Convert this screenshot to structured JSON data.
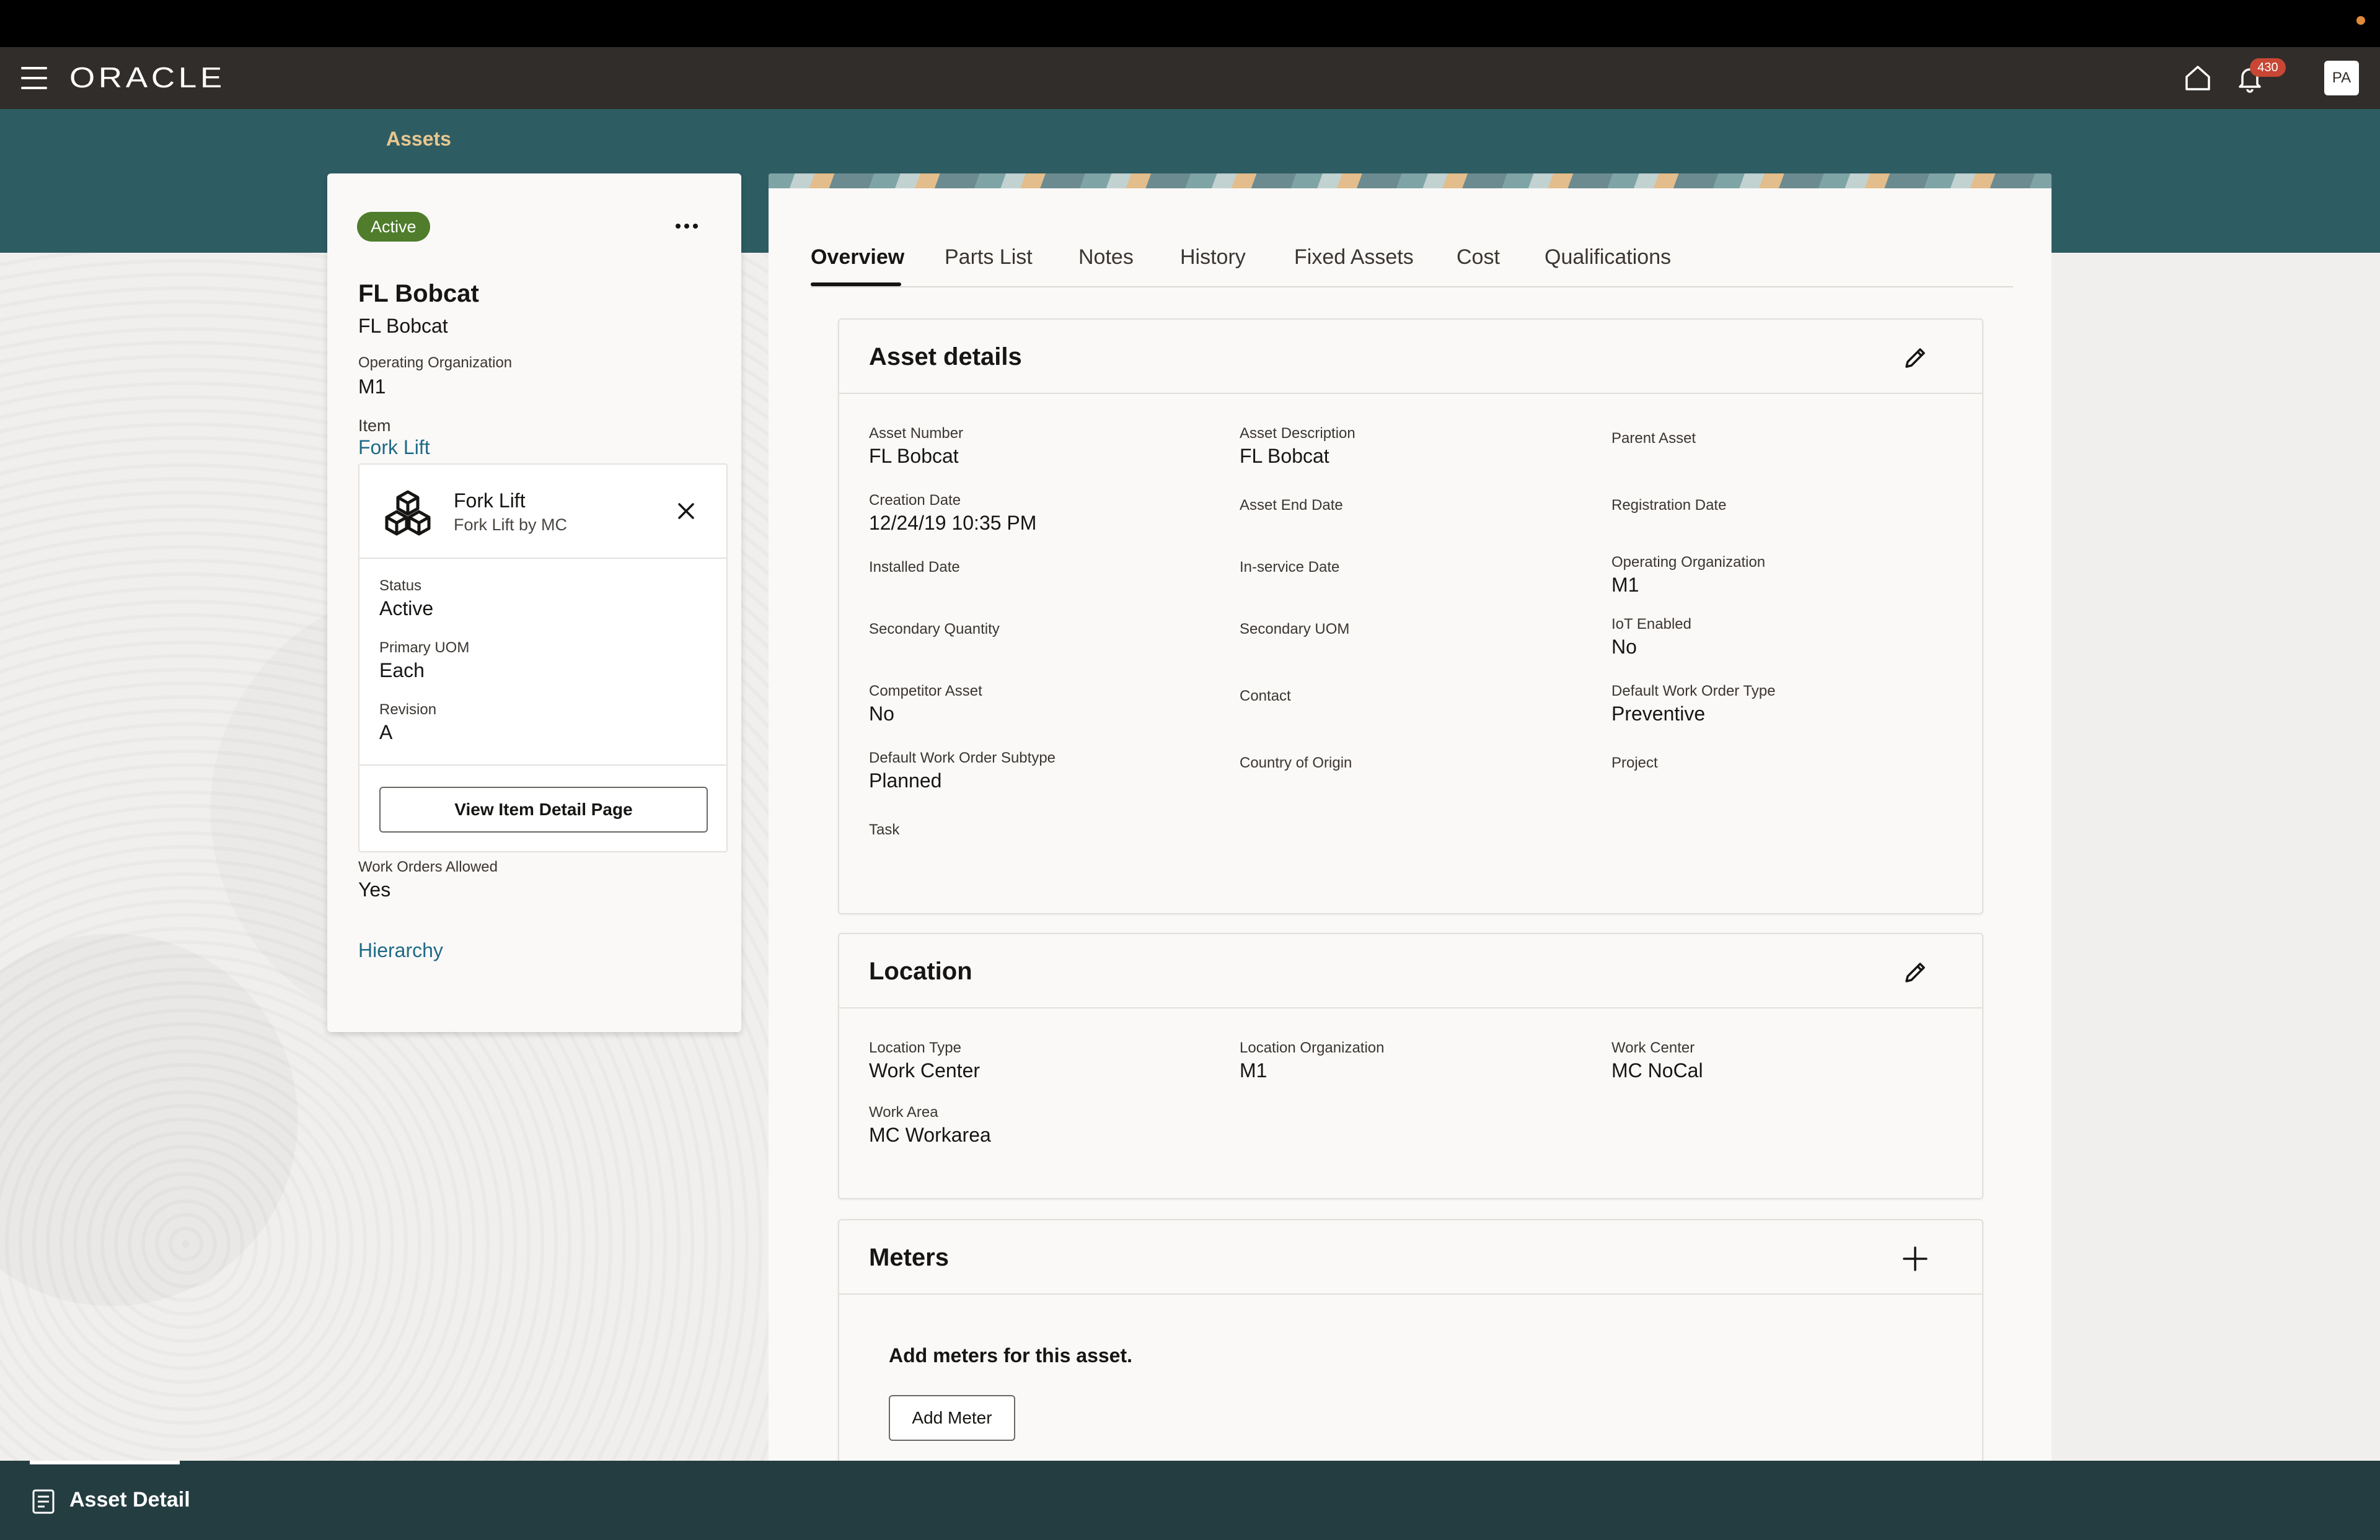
{
  "app": {
    "logo": "ORACLE",
    "notification_count": "430",
    "user_initials": "PA"
  },
  "breadcrumb": "Assets",
  "asset_card": {
    "status": "Active",
    "title": "FL Bobcat",
    "subtitle": "FL Bobcat",
    "operating_org_label": "Operating Organization",
    "operating_org_value": "M1",
    "item_label": "Item",
    "item_value": "Fork Lift",
    "work_orders_label": "Work Orders Allowed",
    "work_orders_value": "Yes",
    "hierarchy_link": "Hierarchy"
  },
  "item_popup": {
    "title": "Fork Lift",
    "subtitle": "Fork Lift by MC",
    "status_label": "Status",
    "status_value": "Active",
    "uom_label": "Primary UOM",
    "uom_value": "Each",
    "revision_label": "Revision",
    "revision_value": "A",
    "button_label": "View Item Detail Page"
  },
  "tabs": [
    "Overview",
    "Parts List",
    "Notes",
    "History",
    "Fixed Assets",
    "Cost",
    "Qualifications"
  ],
  "asset_details": {
    "title": "Asset details",
    "fields": [
      {
        "label": "Asset Number",
        "value": "FL Bobcat"
      },
      {
        "label": "Asset Description",
        "value": "FL Bobcat"
      },
      {
        "label": "Parent Asset",
        "value": ""
      },
      {
        "label": "Creation Date",
        "value": "12/24/19 10:35 PM"
      },
      {
        "label": "Asset End Date",
        "value": ""
      },
      {
        "label": "Registration Date",
        "value": ""
      },
      {
        "label": "Installed Date",
        "value": ""
      },
      {
        "label": "In-service Date",
        "value": ""
      },
      {
        "label": "Operating Organization",
        "value": "M1"
      },
      {
        "label": "Secondary Quantity",
        "value": ""
      },
      {
        "label": "Secondary UOM",
        "value": ""
      },
      {
        "label": "IoT Enabled",
        "value": "No"
      },
      {
        "label": "Competitor Asset",
        "value": "No"
      },
      {
        "label": "Contact",
        "value": ""
      },
      {
        "label": "Default Work Order Type",
        "value": "Preventive"
      },
      {
        "label": "Default Work Order Subtype",
        "value": "Planned"
      },
      {
        "label": "Country of Origin",
        "value": ""
      },
      {
        "label": "Project",
        "value": ""
      },
      {
        "label": "Task",
        "value": ""
      }
    ]
  },
  "location": {
    "title": "Location",
    "fields": [
      {
        "label": "Location Type",
        "value": "Work Center"
      },
      {
        "label": "Location Organization",
        "value": "M1"
      },
      {
        "label": "Work Center",
        "value": "MC NoCal"
      },
      {
        "label": "Work Area",
        "value": "MC Workarea"
      }
    ]
  },
  "meters": {
    "title": "Meters",
    "empty_text": "Add meters for this asset.",
    "button_label": "Add Meter"
  },
  "footer": {
    "label": "Asset Detail"
  },
  "colors": {
    "banner": "#2e5c63",
    "appbar": "#312d2a",
    "active_chip": "#4f7d2b",
    "link": "#1f6b87",
    "badge": "#c74634"
  }
}
